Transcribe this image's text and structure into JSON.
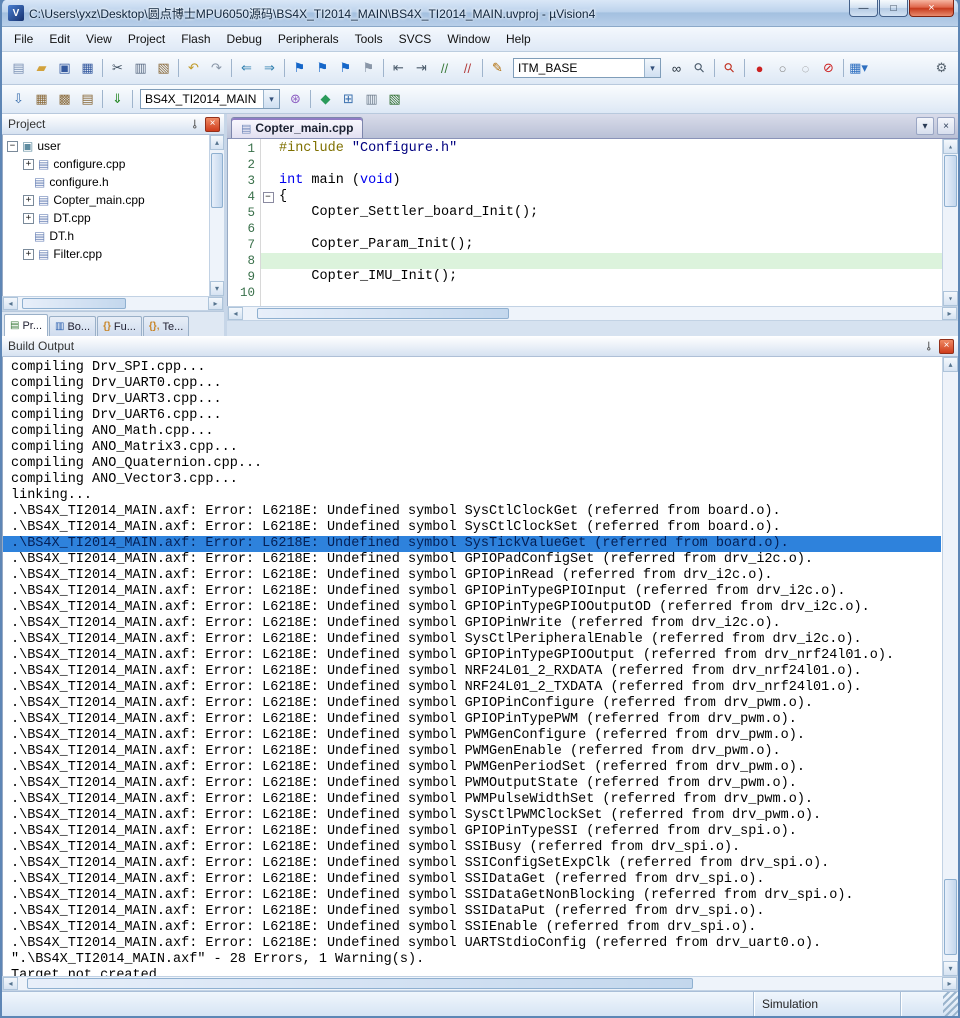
{
  "window": {
    "title": "C:\\Users\\yxz\\Desktop\\圆点博士MPU6050源码\\BS4X_TI2014_MAIN\\BS4X_TI2014_MAIN.uvproj - µVision4",
    "app_icon_glyph": "V"
  },
  "window_controls": [
    {
      "name": "minimize-button",
      "glyph": "—"
    },
    {
      "name": "maximize-button",
      "glyph": "□"
    },
    {
      "name": "close-button",
      "glyph": "×"
    }
  ],
  "menu": {
    "items": [
      "File",
      "Edit",
      "View",
      "Project",
      "Flash",
      "Debug",
      "Peripherals",
      "Tools",
      "SVCS",
      "Window",
      "Help"
    ]
  },
  "toolbar_main": {
    "items": [
      {
        "k": "icon",
        "n": "new-file-icon",
        "g": "▤",
        "c": "#7d93b5"
      },
      {
        "k": "icon",
        "n": "open-folder-icon",
        "g": "▰",
        "c": "#d2a23c"
      },
      {
        "k": "icon",
        "n": "save-icon",
        "g": "▣",
        "c": "#33589e"
      },
      {
        "k": "icon",
        "n": "save-all-icon",
        "g": "▦",
        "c": "#33589e"
      },
      {
        "k": "sep"
      },
      {
        "k": "icon",
        "n": "cut-icon",
        "g": "✂",
        "c": "#3c4c5c"
      },
      {
        "k": "icon",
        "n": "copy-icon",
        "g": "▥",
        "c": "#5c6c84"
      },
      {
        "k": "icon",
        "n": "paste-icon",
        "g": "▧",
        "c": "#8a6a3a"
      },
      {
        "k": "sep"
      },
      {
        "k": "icon",
        "n": "undo-icon",
        "g": "↶",
        "c": "#c09a28"
      },
      {
        "k": "icon",
        "n": "redo-icon",
        "g": "↷",
        "c": "#8a97a8"
      },
      {
        "k": "sep"
      },
      {
        "k": "icon",
        "n": "navigate-back-icon",
        "g": "⇐",
        "c": "#2f7fae"
      },
      {
        "k": "icon",
        "n": "navigate-forward-icon",
        "g": "⇒",
        "c": "#2f7fae"
      },
      {
        "k": "sep"
      },
      {
        "k": "icon",
        "n": "bookmark-toggle-icon",
        "g": "⚑",
        "c": "#1667c9"
      },
      {
        "k": "icon",
        "n": "bookmark-prev-icon",
        "g": "⚑",
        "c": "#1667c9"
      },
      {
        "k": "icon",
        "n": "bookmark-next-icon",
        "g": "⚑",
        "c": "#1667c9"
      },
      {
        "k": "icon",
        "n": "bookmark-clear-icon",
        "g": "⚑",
        "c": "#8a97a8"
      },
      {
        "k": "sep"
      },
      {
        "k": "icon",
        "n": "unindent-icon",
        "g": "⇤",
        "c": "#4c5c6c"
      },
      {
        "k": "icon",
        "n": "indent-icon",
        "g": "⇥",
        "c": "#4c5c6c"
      },
      {
        "k": "icon",
        "n": "comment-icon",
        "g": "//",
        "c": "#3a7a3a"
      },
      {
        "k": "icon",
        "n": "uncomment-icon",
        "g": "//",
        "c": "#b23a3a"
      },
      {
        "k": "sep"
      },
      {
        "k": "icon",
        "n": "configure-flags-icon",
        "g": "✎",
        "c": "#b06a00"
      },
      {
        "k": "combo",
        "n": "itm-base-combo",
        "v": "ITM_BASE",
        "w": 148
      },
      {
        "k": "icon",
        "n": "find-in-files-icon",
        "g": "∞",
        "c": "#24303c"
      },
      {
        "k": "icon",
        "n": "find-icon",
        "g": "⚲",
        "c": "#4c5c6c",
        "r": -45
      },
      {
        "k": "sep"
      },
      {
        "k": "icon",
        "n": "debug-icon",
        "g": "⚲",
        "c": "#c03020",
        "r": -45
      },
      {
        "k": "sep"
      },
      {
        "k": "icon",
        "n": "breakpoint-icon",
        "g": "●",
        "c": "#cc2222"
      },
      {
        "k": "icon",
        "n": "breakpoint-disable-icon",
        "g": "○",
        "c": "#888888"
      },
      {
        "k": "icon",
        "n": "breakpoint-disable-all-icon",
        "g": "◌",
        "c": "#888888"
      },
      {
        "k": "icon",
        "n": "breakpoint-kill-all-icon",
        "g": "⊘",
        "c": "#cc2222"
      },
      {
        "k": "sep"
      },
      {
        "k": "icon",
        "n": "window-layout-icon",
        "g": "▦▾",
        "c": "#2e6fc0"
      },
      {
        "k": "spacer"
      },
      {
        "k": "icon",
        "n": "configure-tools-icon",
        "g": "⚙",
        "c": "#55626e"
      }
    ]
  },
  "toolbar_build": {
    "items": [
      {
        "k": "icon",
        "n": "translate-icon",
        "g": "⇩",
        "c": "#3a6fae"
      },
      {
        "k": "icon",
        "n": "build-icon",
        "g": "▦",
        "c": "#8a6a3a"
      },
      {
        "k": "icon",
        "n": "rebuild-icon",
        "g": "▩",
        "c": "#8a6a3a"
      },
      {
        "k": "icon",
        "n": "batch-build-icon",
        "g": "▤",
        "c": "#8a6a3a"
      },
      {
        "k": "sep"
      },
      {
        "k": "icon",
        "n": "download-icon",
        "g": "⇓",
        "c": "#2a8a2a"
      },
      {
        "k": "sep"
      },
      {
        "k": "combo",
        "n": "target-select-combo",
        "v": "BS4X_TI2014_MAIN",
        "w": 140
      },
      {
        "k": "icon",
        "n": "target-options-icon",
        "g": "⊛",
        "c": "#8a5ac0"
      },
      {
        "k": "sep"
      },
      {
        "k": "icon",
        "n": "manage-runtime-icon",
        "g": "◆",
        "c": "#2a9a5a"
      },
      {
        "k": "icon",
        "n": "manage-items-icon",
        "g": "⊞",
        "c": "#3a6fae"
      },
      {
        "k": "icon",
        "n": "file-extensions-icon",
        "g": "▥",
        "c": "#6e7c8c"
      },
      {
        "k": "icon",
        "n": "books-icon",
        "g": "▧",
        "c": "#2a6a2a"
      }
    ]
  },
  "project_panel": {
    "title": "Project",
    "tree": [
      {
        "label": "user",
        "level": 0,
        "exp": "−",
        "icon": "group-icon",
        "glyph": "▣",
        "color": "#5f8ca0"
      },
      {
        "label": "configure.cpp",
        "level": 1,
        "exp": "+",
        "icon": "source-file-icon",
        "glyph": "▤",
        "color": "#6e86b8"
      },
      {
        "label": "configure.h",
        "level": 1,
        "exp": null,
        "icon": "header-file-icon",
        "glyph": "▤",
        "color": "#6e86b8"
      },
      {
        "label": "Copter_main.cpp",
        "level": 1,
        "exp": "+",
        "icon": "source-file-icon",
        "glyph": "▤",
        "color": "#6e86b8"
      },
      {
        "label": "DT.cpp",
        "level": 1,
        "exp": "+",
        "icon": "source-file-icon",
        "glyph": "▤",
        "color": "#6e86b8"
      },
      {
        "label": "DT.h",
        "level": 1,
        "exp": null,
        "icon": "header-file-icon",
        "glyph": "▤",
        "color": "#6e86b8"
      },
      {
        "label": "Filter.cpp",
        "level": 1,
        "exp": "+",
        "icon": "source-file-icon",
        "glyph": "▤",
        "color": "#6e86b8"
      }
    ],
    "tabs": [
      {
        "name": "project-tab",
        "label": "Pr...",
        "icon": "▤",
        "icon_color": "#3a7a3a",
        "active": true
      },
      {
        "name": "books-tab",
        "label": "Bo...",
        "icon": "▥",
        "icon_color": "#2a5fae",
        "active": false
      },
      {
        "name": "functions-tab",
        "label": "Fu...",
        "icon": "{}",
        "icon_color": "#c8862a",
        "active": false
      },
      {
        "name": "templates-tab",
        "label": "Te...",
        "icon": "{},",
        "icon_color": "#c8862a",
        "active": false
      }
    ]
  },
  "editor": {
    "tabs": [
      {
        "label": "Copter_main.cpp",
        "icon": "▤",
        "active": true
      }
    ],
    "tab_list_glyph": "▾",
    "tab_close_glyph": "×",
    "lines": [
      {
        "num": 1,
        "seg": [
          {
            "t": "#include ",
            "c": "pp"
          },
          {
            "t": "\"Configure.h\"",
            "c": "str"
          }
        ]
      },
      {
        "num": 2,
        "seg": []
      },
      {
        "num": 3,
        "seg": [
          {
            "t": "int",
            "c": "kw"
          },
          {
            "t": " main (",
            "c": "pl"
          },
          {
            "t": "void",
            "c": "kw"
          },
          {
            "t": ")",
            "c": "pl"
          }
        ]
      },
      {
        "num": 4,
        "seg": [
          {
            "t": "{",
            "c": "pl"
          }
        ],
        "fold": "−"
      },
      {
        "num": 5,
        "seg": [
          {
            "t": "    Copter_Settler_board_Init();",
            "c": "pl"
          }
        ]
      },
      {
        "num": 6,
        "seg": []
      },
      {
        "num": 7,
        "seg": [
          {
            "t": "    Copter_Param_Init();",
            "c": "pl"
          }
        ]
      },
      {
        "num": 8,
        "seg": [],
        "hl": true
      },
      {
        "num": 9,
        "seg": [
          {
            "t": "    Copter_IMU_Init();",
            "c": "pl"
          }
        ]
      },
      {
        "num": 10,
        "seg": []
      }
    ]
  },
  "build_output": {
    "title": "Build Output",
    "highlight_index": 11,
    "lines": [
      "compiling Drv_SPI.cpp...",
      "compiling Drv_UART0.cpp...",
      "compiling Drv_UART3.cpp...",
      "compiling Drv_UART6.cpp...",
      "compiling ANO_Math.cpp...",
      "compiling ANO_Matrix3.cpp...",
      "compiling ANO_Quaternion.cpp...",
      "compiling ANO_Vector3.cpp...",
      "linking...",
      ".\\BS4X_TI2014_MAIN.axf: Error: L6218E: Undefined symbol SysCtlClockGet (referred from board.o).",
      ".\\BS4X_TI2014_MAIN.axf: Error: L6218E: Undefined symbol SysCtlClockSet (referred from board.o).",
      ".\\BS4X_TI2014_MAIN.axf: Error: L6218E: Undefined symbol SysTickValueGet (referred from board.o).",
      ".\\BS4X_TI2014_MAIN.axf: Error: L6218E: Undefined symbol GPIOPadConfigSet (referred from drv_i2c.o).",
      ".\\BS4X_TI2014_MAIN.axf: Error: L6218E: Undefined symbol GPIOPinRead (referred from drv_i2c.o).",
      ".\\BS4X_TI2014_MAIN.axf: Error: L6218E: Undefined symbol GPIOPinTypeGPIOInput (referred from drv_i2c.o).",
      ".\\BS4X_TI2014_MAIN.axf: Error: L6218E: Undefined symbol GPIOPinTypeGPIOOutputOD (referred from drv_i2c.o).",
      ".\\BS4X_TI2014_MAIN.axf: Error: L6218E: Undefined symbol GPIOPinWrite (referred from drv_i2c.o).",
      ".\\BS4X_TI2014_MAIN.axf: Error: L6218E: Undefined symbol SysCtlPeripheralEnable (referred from drv_i2c.o).",
      ".\\BS4X_TI2014_MAIN.axf: Error: L6218E: Undefined symbol GPIOPinTypeGPIOOutput (referred from drv_nrf24l01.o).",
      ".\\BS4X_TI2014_MAIN.axf: Error: L6218E: Undefined symbol NRF24L01_2_RXDATA (referred from drv_nrf24l01.o).",
      ".\\BS4X_TI2014_MAIN.axf: Error: L6218E: Undefined symbol NRF24L01_2_TXDATA (referred from drv_nrf24l01.o).",
      ".\\BS4X_TI2014_MAIN.axf: Error: L6218E: Undefined symbol GPIOPinConfigure (referred from drv_pwm.o).",
      ".\\BS4X_TI2014_MAIN.axf: Error: L6218E: Undefined symbol GPIOPinTypePWM (referred from drv_pwm.o).",
      ".\\BS4X_TI2014_MAIN.axf: Error: L6218E: Undefined symbol PWMGenConfigure (referred from drv_pwm.o).",
      ".\\BS4X_TI2014_MAIN.axf: Error: L6218E: Undefined symbol PWMGenEnable (referred from drv_pwm.o).",
      ".\\BS4X_TI2014_MAIN.axf: Error: L6218E: Undefined symbol PWMGenPeriodSet (referred from drv_pwm.o).",
      ".\\BS4X_TI2014_MAIN.axf: Error: L6218E: Undefined symbol PWMOutputState (referred from drv_pwm.o).",
      ".\\BS4X_TI2014_MAIN.axf: Error: L6218E: Undefined symbol PWMPulseWidthSet (referred from drv_pwm.o).",
      ".\\BS4X_TI2014_MAIN.axf: Error: L6218E: Undefined symbol SysCtlPWMClockSet (referred from drv_pwm.o).",
      ".\\BS4X_TI2014_MAIN.axf: Error: L6218E: Undefined symbol GPIOPinTypeSSI (referred from drv_spi.o).",
      ".\\BS4X_TI2014_MAIN.axf: Error: L6218E: Undefined symbol SSIBusy (referred from drv_spi.o).",
      ".\\BS4X_TI2014_MAIN.axf: Error: L6218E: Undefined symbol SSIConfigSetExpClk (referred from drv_spi.o).",
      ".\\BS4X_TI2014_MAIN.axf: Error: L6218E: Undefined symbol SSIDataGet (referred from drv_spi.o).",
      ".\\BS4X_TI2014_MAIN.axf: Error: L6218E: Undefined symbol SSIDataGetNonBlocking (referred from drv_spi.o).",
      ".\\BS4X_TI2014_MAIN.axf: Error: L6218E: Undefined symbol SSIDataPut (referred from drv_spi.o).",
      ".\\BS4X_TI2014_MAIN.axf: Error: L6218E: Undefined symbol SSIEnable (referred from drv_spi.o).",
      ".\\BS4X_TI2014_MAIN.axf: Error: L6218E: Undefined symbol UARTStdioConfig (referred from drv_uart0.o).",
      "\".\\BS4X_TI2014_MAIN.axf\" - 28 Errors, 1 Warning(s).",
      "Target not created"
    ]
  },
  "status_bar": {
    "mode": "Simulation"
  },
  "panel": {
    "pin_glyph": "⊸",
    "close_glyph": "×"
  },
  "scrollbar": {
    "up": "▴",
    "down": "▾",
    "left": "◂",
    "right": "▸"
  },
  "colors": {
    "selection": "#2e82dc",
    "current_line": "#dcf3dc",
    "titlebar": "#bdd3ec",
    "keyword": "#0000ee",
    "string": "#00007f",
    "preprocessor": "#7f7000"
  }
}
